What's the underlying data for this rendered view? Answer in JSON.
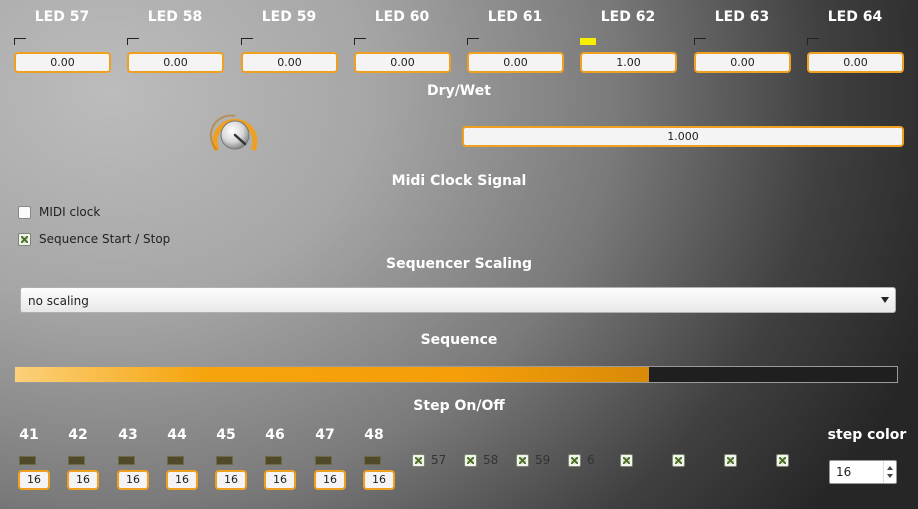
{
  "leds": [
    {
      "label": "LED 57",
      "value": "0.00",
      "on": false
    },
    {
      "label": "LED 58",
      "value": "0.00",
      "on": false
    },
    {
      "label": "LED 59",
      "value": "0.00",
      "on": false
    },
    {
      "label": "LED 60",
      "value": "0.00",
      "on": false
    },
    {
      "label": "LED 61",
      "value": "0.00",
      "on": false
    },
    {
      "label": "LED 62",
      "value": "1.00",
      "on": true
    },
    {
      "label": "LED 63",
      "value": "0.00",
      "on": false
    },
    {
      "label": "LED 64",
      "value": "0.00",
      "on": false
    }
  ],
  "dry_wet": {
    "title": "Dry/Wet",
    "value": "1.000",
    "knob_icon": "knob-icon"
  },
  "midi_clock": {
    "title": "Midi Clock Signal",
    "options": [
      {
        "label": "MIDI clock",
        "checked": false
      },
      {
        "label": "Sequence Start / Stop",
        "checked": true
      }
    ]
  },
  "scaling": {
    "title": "Sequencer Scaling",
    "selected": "no scaling"
  },
  "sequence": {
    "title": "Sequence",
    "progress": 0.719
  },
  "steps": {
    "title": "Step On/Off",
    "numbered": [
      {
        "num": "41",
        "value": "16"
      },
      {
        "num": "42",
        "value": "16"
      },
      {
        "num": "43",
        "value": "16"
      },
      {
        "num": "44",
        "value": "16"
      },
      {
        "num": "45",
        "value": "16"
      },
      {
        "num": "46",
        "value": "16"
      },
      {
        "num": "47",
        "value": "16"
      },
      {
        "num": "48",
        "value": "16"
      }
    ],
    "toggles": [
      {
        "label": "57",
        "checked": true
      },
      {
        "label": "58",
        "checked": true
      },
      {
        "label": "59",
        "checked": true
      },
      {
        "label": "6",
        "checked": true
      },
      {
        "label": "",
        "checked": true
      },
      {
        "label": "",
        "checked": true
      },
      {
        "label": "",
        "checked": true
      },
      {
        "label": "",
        "checked": true
      }
    ]
  },
  "step_color": {
    "title": "step color",
    "value": "16"
  },
  "colors": {
    "accent": "#f0a020",
    "led_on": "#f7ee00",
    "progress": "#f59e0a"
  }
}
